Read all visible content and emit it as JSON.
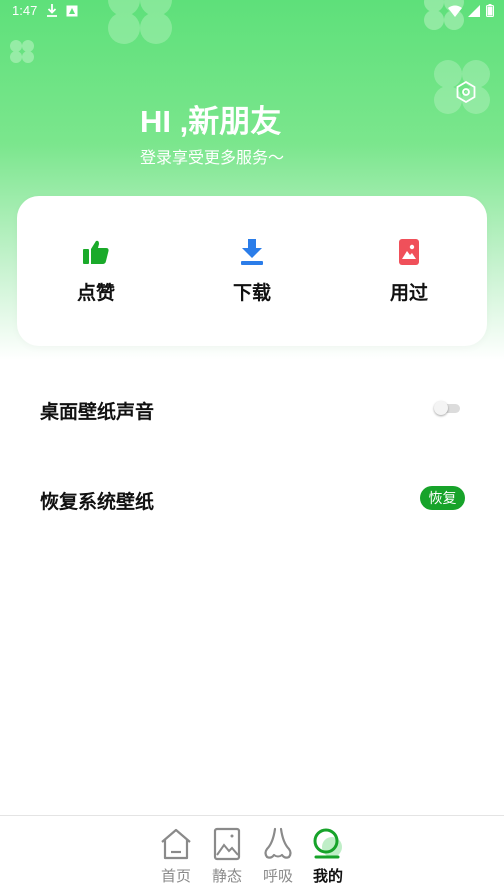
{
  "status_bar": {
    "time": "1:47",
    "icons_left": [
      "download-icon",
      "app-notification-icon"
    ],
    "icons_right": [
      "wifi-icon",
      "signal-icon",
      "battery-icon"
    ]
  },
  "header": {
    "greeting": "HI ,新朋友",
    "subtitle": "登录享受更多服务～",
    "settings_icon": "settings-icon"
  },
  "quick_actions": [
    {
      "label": "点赞",
      "icon": "thumbs-up-icon",
      "color": "#1aaa2a"
    },
    {
      "label": "下载",
      "icon": "download-icon",
      "color": "#2b7de9"
    },
    {
      "label": "用过",
      "icon": "image-icon",
      "color": "#f0505a"
    }
  ],
  "settings": {
    "sound_label": "桌面壁纸声音",
    "sound_enabled": false,
    "restore_label": "恢复系统壁纸",
    "restore_button": "恢复"
  },
  "bottom_nav": [
    {
      "label": "首页",
      "icon": "home-icon",
      "active": false
    },
    {
      "label": "静态",
      "icon": "picture-icon",
      "active": false
    },
    {
      "label": "呼吸",
      "icon": "breath-icon",
      "active": false
    },
    {
      "label": "我的",
      "icon": "profile-icon",
      "active": true
    }
  ],
  "colors": {
    "accent": "#1aaa2a",
    "hero_top": "#5ee07a"
  }
}
